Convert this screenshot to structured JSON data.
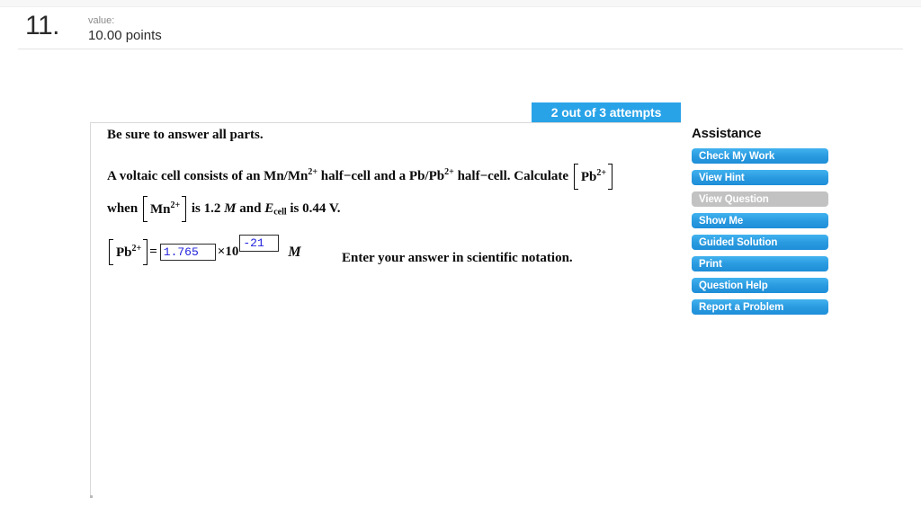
{
  "header": {
    "question_number": "11.",
    "value_label": "value:",
    "value_amount": "10.00 points"
  },
  "attempts": {
    "banner_text": "2 out of 3 attempts",
    "banner_color": "#29a3e8"
  },
  "question": {
    "instruction": "Be sure to answer all parts.",
    "statement_line1": {
      "part1": "A voltaic cell consists of an Mn/Mn",
      "charge1": "2+",
      "part2": " half−cell and a Pb/Pb",
      "charge2": "2+",
      "part3": " half−cell. Calculate",
      "bracket_species": "Pb",
      "bracket_charge": "2+"
    },
    "statement_line2": {
      "part1": "when",
      "bracket_species": "Mn",
      "bracket_charge": "2+",
      "part2": "is 1.2",
      "unit1": "M",
      "part3": "and",
      "symbol_e": "E",
      "symbol_e_sub": "cell",
      "part4": "is 0.44 V."
    }
  },
  "answer": {
    "label_species": "Pb",
    "label_charge": "2+",
    "equals": "=",
    "mantissa_value": "1.765",
    "mantissa_placeholder": "",
    "times_ten": "×10",
    "exponent_value": "-21",
    "exponent_placeholder": "",
    "unit": "M",
    "note": "Enter your answer in scientific notation.",
    "input_text_color": "#2222dd"
  },
  "assistance": {
    "title": "Assistance",
    "buttons": [
      {
        "label": "Check My Work",
        "disabled": false
      },
      {
        "label": "View Hint",
        "disabled": false
      },
      {
        "label": "View Question",
        "disabled": true
      },
      {
        "label": "Show Me",
        "disabled": false
      },
      {
        "label": "Guided Solution",
        "disabled": false
      },
      {
        "label": "Print",
        "disabled": false
      },
      {
        "label": "Question Help",
        "disabled": false
      },
      {
        "label": "Report a Problem",
        "disabled": false
      }
    ]
  }
}
